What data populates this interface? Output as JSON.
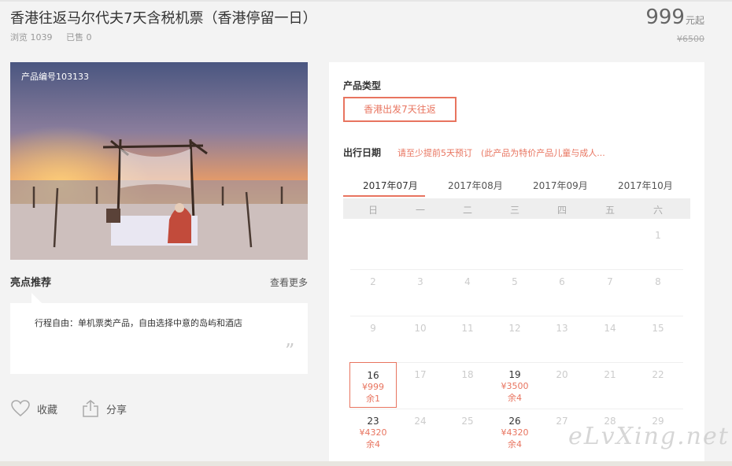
{
  "product": {
    "title": "香港往返马尔代夫7天含税机票（香港停留一日）",
    "views": "浏览 1039",
    "sold": "已售 0",
    "price": "999",
    "price_unit": "元起",
    "original_price": "¥6500",
    "product_id": "产品编号103133"
  },
  "highlights": {
    "title": "亮点推荐",
    "more": "查看更多",
    "text": "行程自由：单机票类产品，自由选择中意的岛屿和酒店",
    "quote": "”"
  },
  "actions": {
    "favorite": "收藏",
    "share": "分享"
  },
  "booking": {
    "product_type_label": "产品类型",
    "product_type_option": "香港出发7天往返",
    "date_label": "出行日期",
    "date_note": "请至少提前5天预订　(此产品为特价产品儿童与成人...",
    "months": [
      "2017年07月",
      "2017年08月",
      "2017年09月",
      "2017年10月"
    ],
    "active_month": "2017年07月",
    "weekdays": [
      "日",
      "一",
      "二",
      "三",
      "四",
      "五",
      "六"
    ],
    "weeks": [
      [
        null,
        null,
        null,
        null,
        null,
        null,
        {
          "day": "1"
        }
      ],
      [
        {
          "day": "2"
        },
        {
          "day": "3"
        },
        {
          "day": "4"
        },
        {
          "day": "5"
        },
        {
          "day": "6"
        },
        {
          "day": "7"
        },
        {
          "day": "8"
        }
      ],
      [
        {
          "day": "9"
        },
        {
          "day": "10"
        },
        {
          "day": "11"
        },
        {
          "day": "12"
        },
        {
          "day": "13"
        },
        {
          "day": "14"
        },
        {
          "day": "15"
        }
      ],
      [
        {
          "day": "16",
          "price": "¥999",
          "remain": "余1",
          "selected": true
        },
        {
          "day": "17"
        },
        {
          "day": "18"
        },
        {
          "day": "19",
          "price": "¥3500",
          "remain": "余4"
        },
        {
          "day": "20"
        },
        {
          "day": "21"
        },
        {
          "day": "22"
        }
      ],
      [
        {
          "day": "23",
          "price": "¥4320",
          "remain": "余4"
        },
        {
          "day": "24"
        },
        {
          "day": "25"
        },
        {
          "day": "26",
          "price": "¥4320",
          "remain": "余4"
        },
        {
          "day": "27"
        },
        {
          "day": "28"
        },
        {
          "day": "29"
        }
      ]
    ]
  },
  "watermark": "eLvXing.net",
  "colors": {
    "accent": "#e8745f",
    "text": "#333333",
    "muted": "#999999"
  }
}
